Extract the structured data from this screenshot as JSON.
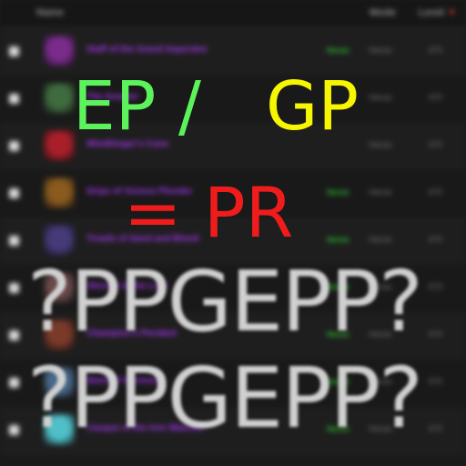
{
  "table": {
    "headers": {
      "name": "Name",
      "mode": "Mode",
      "level": "Level"
    },
    "rows": [
      {
        "name": "Staff of the Grand Imperator",
        "mode_badge": "Heroic",
        "mode": "Heroic",
        "level": "670",
        "icon_color": "#7b2b8c"
      },
      {
        "name": "The Scepter",
        "mode_badge": "",
        "mode": "Heroic",
        "level": "670",
        "icon_color": "#3f6b3f"
      },
      {
        "name": "Windbinger's Cane",
        "mode_badge": "",
        "mode": "Heroic",
        "level": "670",
        "icon_color": "#a81f2a"
      },
      {
        "name": "Grips of Vicious Plunder",
        "mode_badge": "Heroic",
        "mode": "Heroic",
        "level": "670",
        "icon_color": "#8a5a1e"
      },
      {
        "name": "Treads of Sand and Blood",
        "mode_badge": "Heroic",
        "mode": "Heroic",
        "level": "670",
        "icon_color": "#463a78"
      },
      {
        "name": "Shroud of the Lost",
        "mode_badge": "Heroic",
        "mode": "Heroic",
        "level": "670",
        "icon_color": "#6b4a4a"
      },
      {
        "name": "Champion's Pendant",
        "mode_badge": "Heroic",
        "mode": "Heroic",
        "level": "670",
        "icon_color": "#7a3a2a"
      },
      {
        "name": "Band of Harmony",
        "mode_badge": "Heroic",
        "mode": "Heroic",
        "level": "670",
        "icon_color": "#4a6a8a"
      },
      {
        "name": "Casque of the Iron Watcher",
        "mode_badge": "Heroic",
        "mode": "Heroic",
        "level": "670",
        "icon_color": "#4fc0c8"
      }
    ]
  },
  "overlay": {
    "ep": "EP",
    "slash": "/",
    "gp": "GP",
    "equals_pr": "= PR",
    "line1": "?PPGEPP?",
    "line2": "?PPGEPP?"
  }
}
